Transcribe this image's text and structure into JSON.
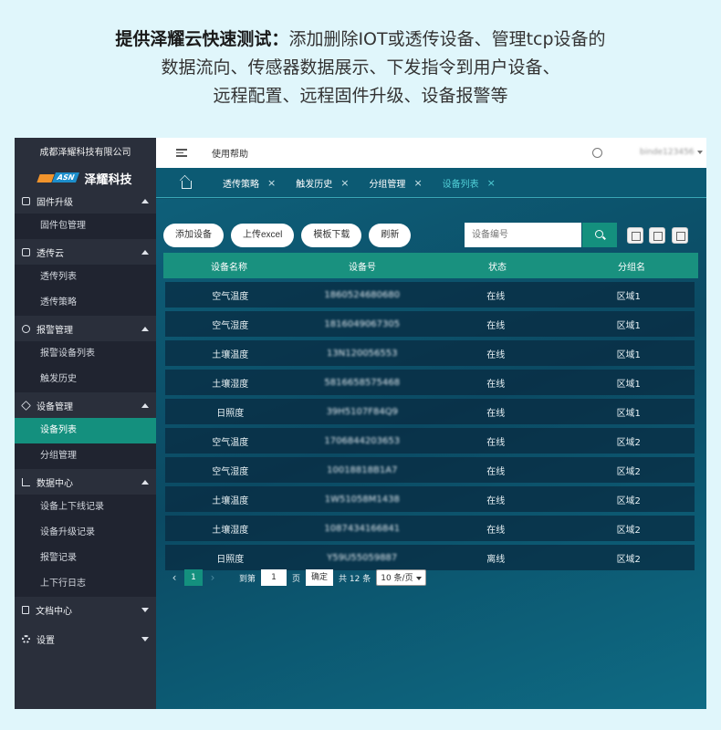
{
  "intro": {
    "bold": "提供泽耀云快速测试：",
    "line1_rest": "添加删除IOT或透传设备、管理tcp设备的",
    "line2": "数据流向、传感器数据展示、下发指令到用户设备、",
    "line3": "远程配置、远程固件升级、设备报警等"
  },
  "sidebar": {
    "company": "成都泽耀科技有限公司",
    "logo_text": "ASN",
    "brand": "泽耀科技",
    "groups": [
      {
        "label": "固件升级",
        "icon": "firmware-icon",
        "expanded": true,
        "items": [
          "固件包管理"
        ]
      },
      {
        "label": "透传云",
        "icon": "cloud-icon",
        "expanded": true,
        "items": [
          "透传列表",
          "透传策略"
        ]
      },
      {
        "label": "报警管理",
        "icon": "alarm-icon",
        "expanded": true,
        "items": [
          "报警设备列表",
          "触发历史"
        ]
      },
      {
        "label": "设备管理",
        "icon": "device-icon",
        "expanded": true,
        "items": [
          "设备列表",
          "分组管理"
        ],
        "active_item": "设备列表"
      },
      {
        "label": "数据中心",
        "icon": "chart-icon",
        "expanded": true,
        "items": [
          "设备上下线记录",
          "设备升级记录",
          "报警记录",
          "上下行日志"
        ]
      },
      {
        "label": "文档中心",
        "icon": "document-icon",
        "expanded": false,
        "items": []
      },
      {
        "label": "设置",
        "icon": "gear-icon",
        "expanded": false,
        "items": []
      }
    ]
  },
  "topbar": {
    "help": "使用帮助",
    "username": "binde123456"
  },
  "tabs": [
    {
      "label": "透传策略",
      "active": false
    },
    {
      "label": "触发历史",
      "active": false
    },
    {
      "label": "分组管理",
      "active": false
    },
    {
      "label": "设备列表",
      "active": true
    }
  ],
  "toolbar": {
    "add": "添加设备",
    "upload": "上传excel",
    "template": "模板下载",
    "refresh": "刷新",
    "search_placeholder": "设备编号"
  },
  "table": {
    "headers": [
      "设备名称",
      "设备号",
      "状态",
      "分组名"
    ],
    "rows": [
      [
        "空气温度",
        "1860524680680",
        "在线",
        "区域1"
      ],
      [
        "空气湿度",
        "1816049067305",
        "在线",
        "区域1"
      ],
      [
        "土壤温度",
        "13N120056553",
        "在线",
        "区域1"
      ],
      [
        "土壤湿度",
        "5816658575468",
        "在线",
        "区域1"
      ],
      [
        "日照度",
        "39H5107F84Q9",
        "在线",
        "区域1"
      ],
      [
        "空气温度",
        "1706844203653",
        "在线",
        "区域2"
      ],
      [
        "空气湿度",
        "10018818B1A7",
        "在线",
        "区域2"
      ],
      [
        "土壤温度",
        "1W51058M1438",
        "在线",
        "区域2"
      ],
      [
        "土壤湿度",
        "1087434166841",
        "在线",
        "区域2"
      ],
      [
        "日照度",
        "Y59U55059887",
        "离线",
        "区域2"
      ]
    ]
  },
  "pager": {
    "prev": "‹",
    "current": "1",
    "next": "›",
    "goto_label": "到第",
    "goto_value": "1",
    "page_unit": "页",
    "confirm": "确定",
    "total": "共 12 条",
    "page_size": "10 条/页"
  }
}
